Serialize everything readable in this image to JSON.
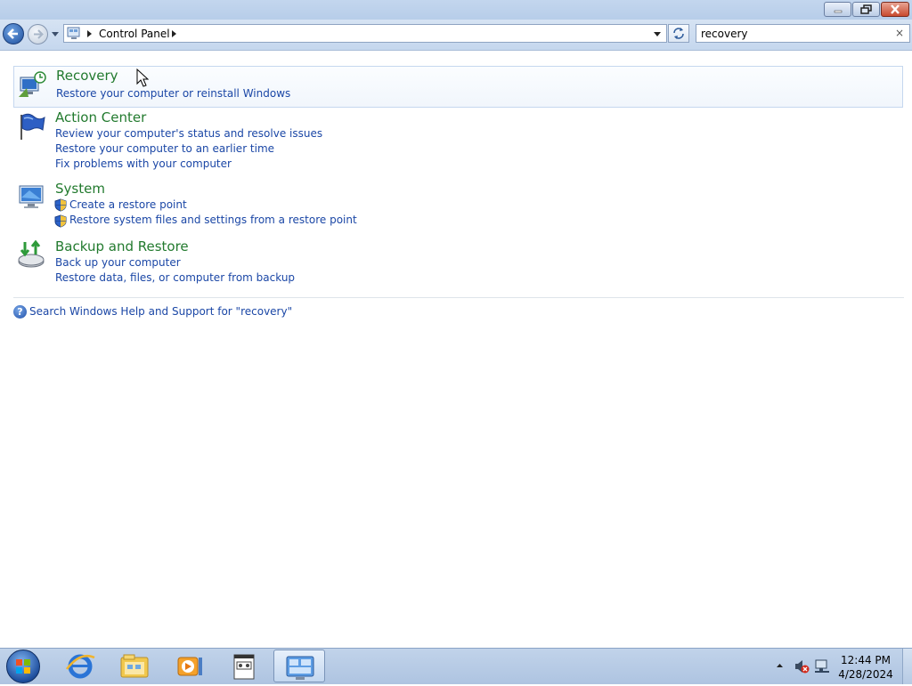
{
  "window": {
    "minimize_icon": "minimize-icon",
    "restore_icon": "restore-icon",
    "close_icon": "close-icon"
  },
  "nav": {
    "breadcrumb": [
      "Control Panel"
    ],
    "search_value": "recovery",
    "clear_glyph": "×"
  },
  "results": [
    {
      "title": "Recovery",
      "icon": "recovery-icon",
      "links": [
        {
          "label": "Restore your computer or reinstall Windows",
          "shield": false
        }
      ]
    },
    {
      "title": "Action Center",
      "icon": "action-center-flag-icon",
      "links": [
        {
          "label": "Review your computer's status and resolve issues",
          "shield": false
        },
        {
          "label": "Restore your computer to an earlier time",
          "shield": false
        },
        {
          "label": "Fix problems with your computer",
          "shield": false
        }
      ]
    },
    {
      "title": "System",
      "icon": "system-computer-icon",
      "links": [
        {
          "label": "Create a restore point",
          "shield": true
        },
        {
          "label": "Restore system files and settings from a restore point",
          "shield": true
        }
      ]
    },
    {
      "title": "Backup and Restore",
      "icon": "backup-restore-icon",
      "links": [
        {
          "label": "Back up your computer",
          "shield": false
        },
        {
          "label": "Restore data, files, or computer from backup",
          "shield": false
        }
      ]
    }
  ],
  "help": {
    "label": "Search Windows Help and Support for \"recovery\""
  },
  "taskbar": {
    "pinned": [
      "internet-explorer-icon",
      "windows-explorer-icon",
      "media-player-icon",
      "notepad-window-icon",
      "control-panel-icon"
    ],
    "clock_time": "12:44 PM",
    "clock_date": "4/28/2024"
  },
  "colors": {
    "title_green": "#227a2e",
    "link_blue": "#1b47a6"
  }
}
